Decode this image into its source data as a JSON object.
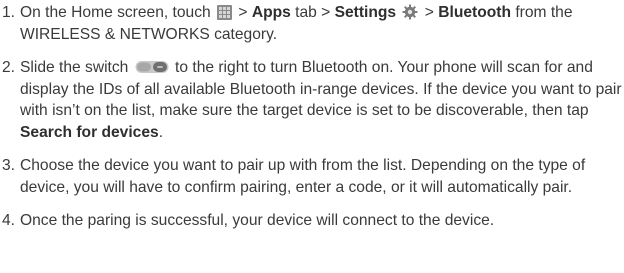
{
  "steps": [
    {
      "num": "1.",
      "p1": "On the Home screen, touch ",
      "p2": " > ",
      "apps": "Apps",
      "p3": " tab > ",
      "settings": "Settings",
      "p4": " > ",
      "bluetooth": "Bluetooth",
      "p5": " from the WIRELESS & NETWORKS category."
    },
    {
      "num": "2.",
      "p1": "Slide the switch ",
      "p2": " to the right to turn Bluetooth on. Your phone will scan for and display the IDs of all available Bluetooth in-range devices. If the device you want to pair with isn’t on the list, make sure the target device is set to be discoverable, then tap ",
      "search": "Search for devices",
      "p3": "."
    },
    {
      "num": "3.",
      "text": "Choose the device you want to pair up with from the list. Depending on the type of device, you will have to confirm pairing, enter a code, or it will automatically pair."
    },
    {
      "num": "4.",
      "text": "Once the paring is successful, your device will connect to the device."
    }
  ],
  "icons": {
    "apps": "apps-grid-icon",
    "settings": "gear-icon",
    "switch": "toggle-switch-icon"
  }
}
